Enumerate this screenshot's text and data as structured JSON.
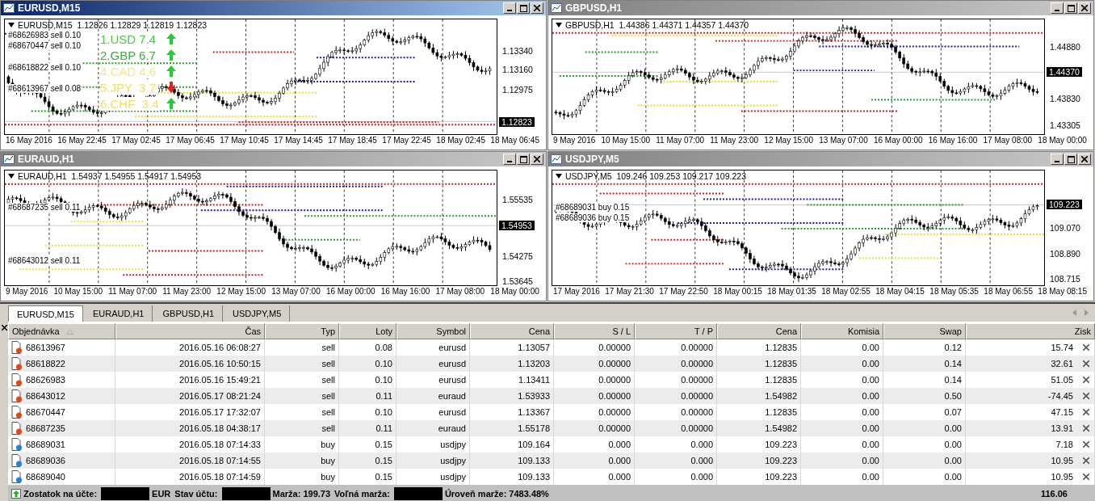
{
  "charts": [
    {
      "title": "EURUSD,M15",
      "active": true,
      "header": "EURUSD,M15  1.12826 1.12829 1.12819 1.12823",
      "orders": [
        "#68626983 sell 0.10",
        "#68670447 sell 0.10",
        "#68618822 sell 0.10",
        "#68613967 sell 0.08"
      ],
      "strength": [
        {
          "text": "1.USD 7.4",
          "color": "#44cc44",
          "rising": true
        },
        {
          "text": "2.GBP 6.7",
          "color": "#44aa44",
          "rising": true
        },
        {
          "text": "4.CAD 4.6",
          "color": "#f0e68c",
          "rising": true
        },
        {
          "text": "5.JPY  3.7",
          "color": "#f0e060",
          "rising": false
        },
        {
          "text": "6.CHF  3.4",
          "color": "#f0e060",
          "rising": true
        }
      ],
      "price_labels": [
        "1.13340",
        "1.13160",
        "1.12975"
      ],
      "current_price": "1.12823",
      "time_labels": [
        "16 May 2016",
        "16 May 22:45",
        "17 May 02:45",
        "17 May 06:45",
        "17 May 10:45",
        "17 May 14:45",
        "17 May 18:45",
        "17 May 22:45",
        "18 May 02:45",
        "18 May 06:45"
      ]
    },
    {
      "title": "GBPUSD,H1",
      "active": false,
      "header": "GBPUSD,H1  1.44386 1.44371 1.44357 1.44370",
      "price_labels": [
        "1.44880",
        "1.43830",
        "1.43305"
      ],
      "current_price": "1.44370",
      "time_labels": [
        "9 May 2016",
        "10 May 15:00",
        "11 May 07:00",
        "11 May 23:00",
        "12 May 15:00",
        "13 May 07:00",
        "16 May 00:00",
        "16 May 16:00",
        "17 May 08:00",
        "18 May 00:00"
      ]
    },
    {
      "title": "EURAUD,H1",
      "active": false,
      "header": "EURAUD,H1  1.54937 1.54955 1.54917 1.54953",
      "orders": [
        "#68687235 sell 0.11",
        "#68643012 sell 0.11"
      ],
      "price_labels": [
        "1.55535",
        "1.54275",
        "1.53645"
      ],
      "current_price": "1.54953",
      "time_labels": [
        "9 May 2016",
        "10 May 15:00",
        "11 May 07:00",
        "11 May 23:00",
        "12 May 15:00",
        "13 May 07:00",
        "16 May 00:00",
        "16 May 16:00",
        "17 May 08:00",
        "18 May 00:00"
      ]
    },
    {
      "title": "USDJPY,M5",
      "active": false,
      "header": "USDJPY,M5  109.246 109.253 109.217 109.223",
      "orders": [
        "#68689031 buy 0.15",
        "#68689036 buy 0.15"
      ],
      "price_labels": [
        "109.070",
        "108.890",
        "108.715"
      ],
      "current_price": "109.223",
      "time_labels": [
        "17 May 2016",
        "17 May 21:30",
        "17 May 22:50",
        "18 May 00:15",
        "18 May 01:35",
        "18 May 02:55",
        "18 May 04:15",
        "18 May 05:35",
        "18 May 06:55",
        "18 May 08:15"
      ]
    }
  ],
  "tabs": [
    {
      "label": "EURUSD,M15",
      "selected": true
    },
    {
      "label": "EURAUD,H1",
      "selected": false
    },
    {
      "label": "GBPUSD,H1",
      "selected": false
    },
    {
      "label": "USDJPY,M5",
      "selected": false
    }
  ],
  "table": {
    "columns": [
      "Objednávka",
      "Čas",
      "Typ",
      "Loty",
      "Symbol",
      "Cena",
      "S / L",
      "T / P",
      "Cena",
      "Komisia",
      "Swap",
      "Zisk"
    ],
    "rows": [
      {
        "kind": "sell",
        "cells": [
          "68613967",
          "2016.05.16 06:08:27",
          "sell",
          "0.08",
          "eurusd",
          "1.13057",
          "0.00000",
          "0.00000",
          "1.12835",
          "0.00",
          "0.12",
          "15.74"
        ]
      },
      {
        "kind": "sell",
        "cells": [
          "68618822",
          "2016.05.16 10:50:15",
          "sell",
          "0.10",
          "eurusd",
          "1.13203",
          "0.00000",
          "0.00000",
          "1.12835",
          "0.00",
          "0.14",
          "32.61"
        ]
      },
      {
        "kind": "sell",
        "cells": [
          "68626983",
          "2016.05.16 15:49:21",
          "sell",
          "0.10",
          "eurusd",
          "1.13411",
          "0.00000",
          "0.00000",
          "1.12835",
          "0.00",
          "0.14",
          "51.05"
        ]
      },
      {
        "kind": "sell",
        "cells": [
          "68643012",
          "2016.05.17 08:21:24",
          "sell",
          "0.11",
          "euraud",
          "1.53933",
          "0.00000",
          "0.00000",
          "1.54982",
          "0.00",
          "0.50",
          "-74.45"
        ]
      },
      {
        "kind": "sell",
        "cells": [
          "68670447",
          "2016.05.17 17:32:07",
          "sell",
          "0.10",
          "eurusd",
          "1.13367",
          "0.00000",
          "0.00000",
          "1.12835",
          "0.00",
          "0.07",
          "47.15"
        ]
      },
      {
        "kind": "sell",
        "cells": [
          "68687235",
          "2016.05.18 04:38:17",
          "sell",
          "0.11",
          "euraud",
          "1.55178",
          "0.00000",
          "0.00000",
          "1.54982",
          "0.00",
          "0.00",
          "13.91"
        ]
      },
      {
        "kind": "buy",
        "cells": [
          "68689031",
          "2016.05.18 07:14:33",
          "buy",
          "0.15",
          "usdjpy",
          "109.164",
          "0.000",
          "0.000",
          "109.223",
          "0.00",
          "0.00",
          "7.18"
        ]
      },
      {
        "kind": "buy",
        "cells": [
          "68689036",
          "2016.05.18 07:14:55",
          "buy",
          "0.15",
          "usdjpy",
          "109.133",
          "0.000",
          "0.000",
          "109.223",
          "0.00",
          "0.00",
          "10.95"
        ]
      },
      {
        "kind": "buy",
        "cells": [
          "68689040",
          "2016.05.18 07:14:59",
          "buy",
          "0.15",
          "usdjpy",
          "109.133",
          "0.000",
          "0.000",
          "109.223",
          "0.00",
          "0.00",
          "10.95"
        ]
      }
    ]
  },
  "footer": {
    "items": [
      {
        "kind": "label",
        "text": "Zostatok na účte:"
      },
      {
        "kind": "redacted"
      },
      {
        "kind": "label",
        "text": "EUR"
      },
      {
        "kind": "label",
        "text": "Stav účtu:"
      },
      {
        "kind": "redacted"
      },
      {
        "kind": "label",
        "text": "Marža: 199.73"
      },
      {
        "kind": "label",
        "text": "Voľná marža:"
      },
      {
        "kind": "redacted"
      },
      {
        "kind": "label",
        "text": "Úroveň marže: 7483.48%"
      }
    ],
    "total": "116.06"
  }
}
